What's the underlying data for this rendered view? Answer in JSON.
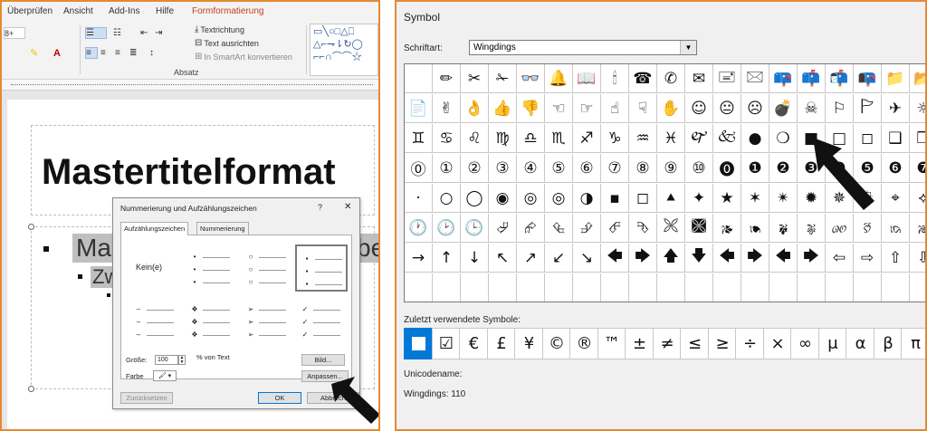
{
  "left": {
    "tabs": [
      "Überprüfen",
      "Ansicht",
      "Add-Ins",
      "Hilfe",
      "Formformatierung"
    ],
    "active_tab": "Formformatierung",
    "ribbon": {
      "font_size": "8+",
      "text_direction": "Textrichtung",
      "align_text": "Text ausrichten",
      "convert_smartart": "In SmartArt konvertieren",
      "group_label": "Absatz"
    },
    "slide": {
      "title": "Mastertitelformat",
      "line1": "Ma",
      "line1_tail": "be",
      "line2": "Zw"
    },
    "dialog": {
      "title": "Nummerierung und Aufzählungszeichen",
      "help": "?",
      "close": "✕",
      "tab_bullets": "Aufzählungszeichen",
      "tab_numbering": "Nummerierung",
      "none_label": "Kein(e)",
      "size_label": "Größe:",
      "size_value": "100",
      "size_unit": "% von Text",
      "color_label": "Farbe",
      "picture_button": "Bild...",
      "customize_button": "Anpassen...",
      "reset_button": "Zurücksetzen",
      "ok_button": "OK",
      "cancel_button": "Abbrech"
    }
  },
  "right": {
    "title": "Symbol",
    "font_label": "Schriftart:",
    "font_value": "Wingdings",
    "grid_rows": [
      [
        " ",
        "✏",
        "✂",
        "✁",
        "👓",
        "🔔",
        "📖",
        "🕯",
        "☎",
        "✆",
        "✉",
        "🖃",
        "🖂",
        "📪",
        "📫",
        "📬",
        "📭",
        "📁",
        "📂"
      ],
      [
        "📄",
        "✌",
        "👌",
        "👍",
        "👎",
        "☜",
        "☞",
        "☝",
        "☟",
        "✋",
        "☺",
        "😐",
        "☹",
        "💣",
        "☠",
        "⚐",
        "🏱",
        "✈",
        "☼"
      ],
      [
        "♊",
        "♋",
        "♌",
        "♍",
        "♎",
        "♏",
        "♐",
        "♑",
        "♒",
        "♓",
        "🙰",
        "🙵",
        "●",
        "❍",
        "■",
        "□",
        "◻",
        "❑",
        "❒"
      ],
      [
        "⓪",
        "①",
        "②",
        "③",
        "④",
        "⑤",
        "⑥",
        "⑦",
        "⑧",
        "⑨",
        "⑩",
        "⓿",
        "❶",
        "❷",
        "❸",
        "❹",
        "❺",
        "❻",
        "❼"
      ],
      [
        "·",
        "○",
        "◯",
        "◉",
        "◎",
        "◎",
        "◑",
        "▪",
        "◻",
        "⯅",
        "✦",
        "★",
        "✶",
        "✴",
        "✹",
        "✵",
        "⯐",
        "⌖",
        "⟡"
      ],
      [
        "🕐",
        "🕑",
        "🕒",
        "⮰",
        "⮳",
        "⮴",
        "⮵",
        "⮶",
        "⮷",
        "🙪",
        "🙫",
        "🙕",
        "🙔",
        "🙗",
        "🙖",
        "🙐",
        "🙑",
        "🙒",
        "🙓"
      ],
      [
        "→",
        "↑",
        "↓",
        "↖",
        "↗",
        "↙",
        "↘",
        "🡄",
        "🡆",
        "🡅",
        "🡇",
        "🡄",
        "🡆",
        "🡄",
        "🡆",
        "⇦",
        "⇨",
        "⇧",
        "⇩"
      ],
      [
        "",
        "",
        "",
        "",
        "",
        "",
        "",
        "",
        "",
        "",
        "",
        "",
        "",
        "",
        "",
        "",
        "",
        "",
        ""
      ]
    ],
    "recent_label": "Zuletzt verwendete Symbole:",
    "recent_symbols": [
      "■",
      "☑",
      "€",
      "£",
      "¥",
      "©",
      "®",
      "™",
      "±",
      "≠",
      "≤",
      "≥",
      "÷",
      "×",
      "∞",
      "μ",
      "α",
      "β",
      "π"
    ],
    "unicode_label": "Unicodename:",
    "wingdings_code": "Wingdings: 110"
  }
}
